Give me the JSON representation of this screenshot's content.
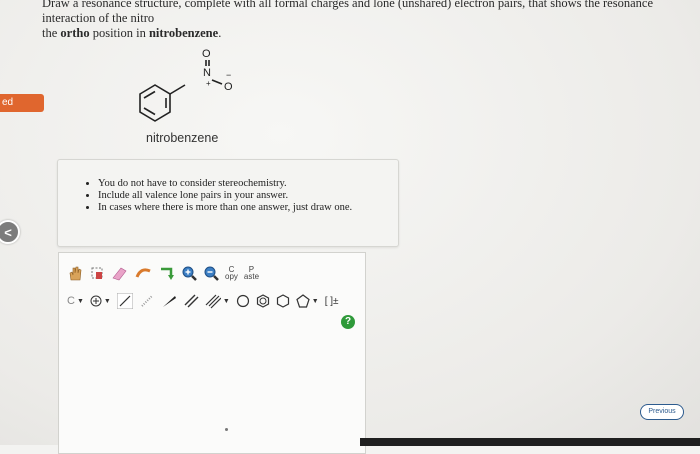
{
  "question": {
    "line1": "Draw a resonance structure, complete with all formal charges and lone (unshared) electron pairs, that shows the resonance interaction of the nitro",
    "line2_prefix": "the ",
    "line2_bold1": "ortho",
    "line2_middle": " position in ",
    "line2_bold2": "nitrobenzene",
    "line2_suffix": "."
  },
  "side_tab": {
    "label": "ed"
  },
  "back": {
    "icon": "chevron-left-icon",
    "glyph": "<"
  },
  "molecule": {
    "label": "nitrobenzene",
    "atom_O_top": "O",
    "atom_N": "N",
    "plus": "+",
    "atom_O_right": "O",
    "minus": "−"
  },
  "notes": {
    "items": [
      "You do not have to consider stereochemistry.",
      "Include all valence lone pairs in your answer.",
      "In cases where there is more than one answer, just draw one."
    ]
  },
  "toolbar": {
    "copy_top": "C",
    "copy_bottom": "opy",
    "paste_top": "P",
    "paste_bottom": "aste",
    "carbon_label": "C",
    "bracket_label": "[ ]±",
    "help": "?"
  },
  "previous": {
    "label": "Previous"
  },
  "colors": {
    "accent": "#e0662e",
    "help": "#2f9a3a",
    "link": "#2d5b8e"
  }
}
